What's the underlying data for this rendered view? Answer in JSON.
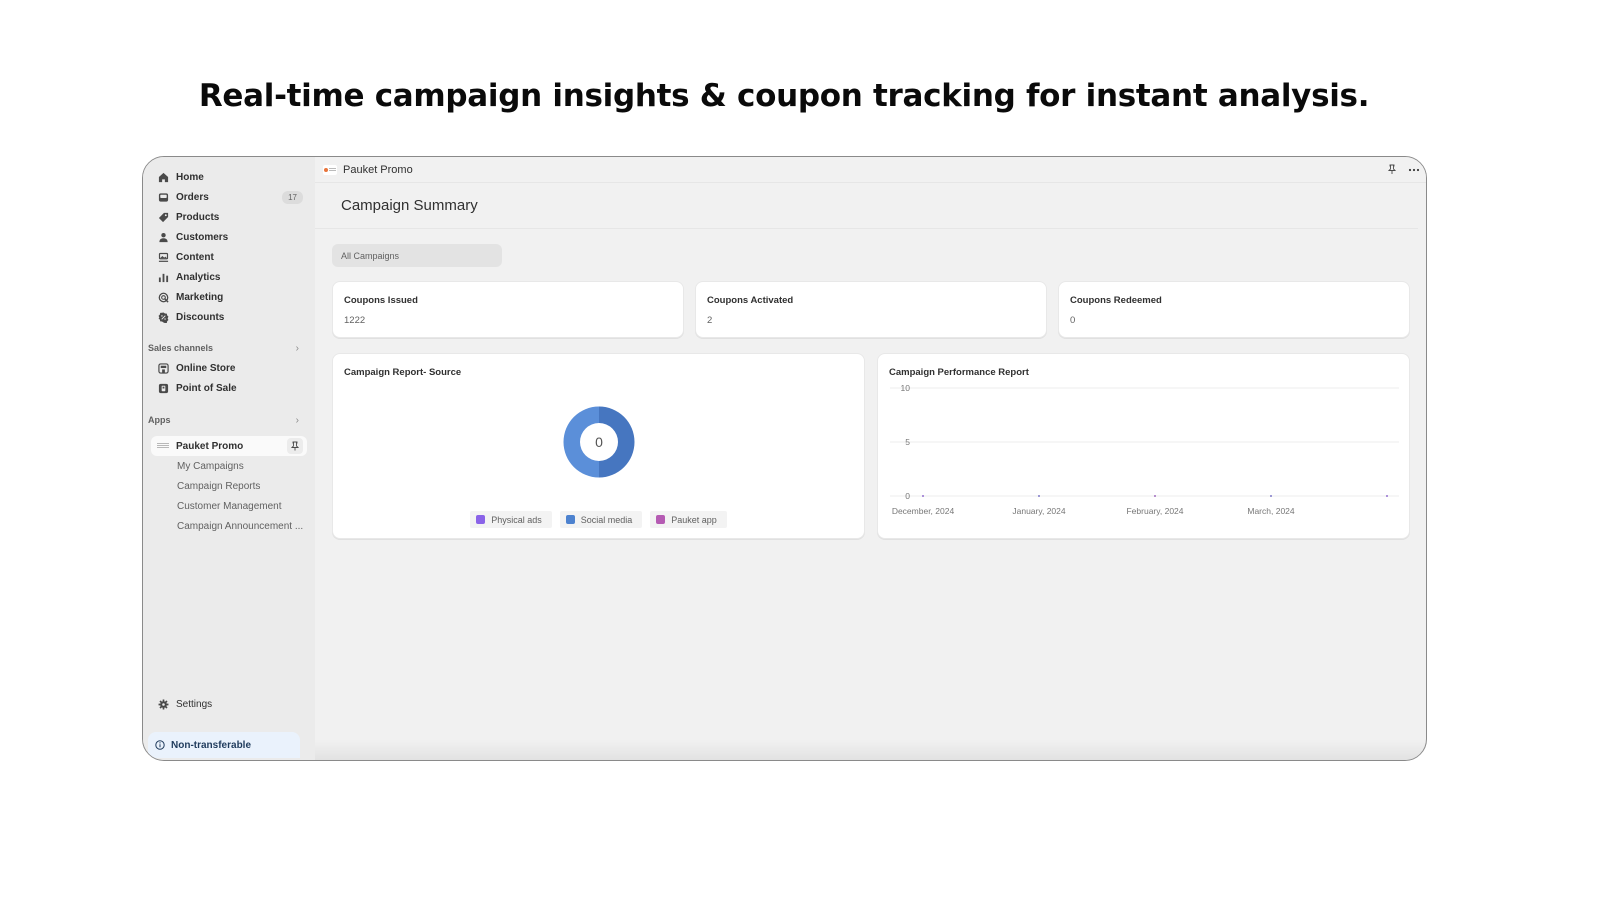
{
  "headline": "Real-time campaign insights & coupon tracking for instant analysis.",
  "sidebar": {
    "nav": [
      {
        "label": "Home",
        "icon": "home-icon"
      },
      {
        "label": "Orders",
        "icon": "inbox-icon",
        "badge": "17"
      },
      {
        "label": "Products",
        "icon": "tag-icon"
      },
      {
        "label": "Customers",
        "icon": "person-icon"
      },
      {
        "label": "Content",
        "icon": "image-icon"
      },
      {
        "label": "Analytics",
        "icon": "bar-chart-icon"
      },
      {
        "label": "Marketing",
        "icon": "target-icon"
      },
      {
        "label": "Discounts",
        "icon": "discount-badge-icon"
      }
    ],
    "sales_channels": {
      "heading": "Sales channels",
      "items": [
        {
          "label": "Online Store",
          "icon": "store-icon"
        },
        {
          "label": "Point of Sale",
          "icon": "pos-icon"
        }
      ]
    },
    "apps": {
      "heading": "Apps",
      "app": {
        "label": "Pauket Promo",
        "icon": "pauket-logo-icon"
      },
      "sub_items": [
        "My Campaigns",
        "Campaign Reports",
        "Customer Management",
        "Campaign Announcement ..."
      ]
    },
    "settings_label": "Settings",
    "non_transferable_label": "Non-transferable"
  },
  "topbar": {
    "app_name": "Pauket Promo"
  },
  "page": {
    "title": "Campaign Summary",
    "filter_value": "All Campaigns"
  },
  "stats": [
    {
      "title": "Coupons Issued",
      "value": "1222"
    },
    {
      "title": "Coupons Activated",
      "value": "2"
    },
    {
      "title": "Coupons Redeemed",
      "value": "0"
    }
  ],
  "colors": {
    "physical_ads": "#8a63e8",
    "social_media": "#4d82cf",
    "pauket_app": "#b55bb3",
    "donut_light": "#5b8fd9",
    "donut_dark": "#4676c0"
  },
  "chart_data": [
    {
      "type": "pie",
      "title": "Campaign Report- Source",
      "center_label": "0",
      "categories": [
        "Physical ads",
        "Social media",
        "Pauket app"
      ],
      "values": [
        0,
        0,
        0
      ],
      "legend": "bottom"
    },
    {
      "type": "line",
      "title": "Campaign Performance Report",
      "categories": [
        "December, 2024",
        "January, 2024",
        "February, 2024",
        "March, 2024",
        ""
      ],
      "series": [
        {
          "name": "Physical ads",
          "values": [
            0,
            0,
            0,
            0,
            0
          ]
        },
        {
          "name": "Social media",
          "values": [
            0,
            0,
            0,
            0,
            0
          ]
        },
        {
          "name": "Pauket app",
          "values": [
            0,
            0,
            0,
            0,
            0
          ]
        }
      ],
      "yticks": [
        0,
        5,
        10
      ],
      "ylim": [
        0,
        10
      ],
      "grid": true
    }
  ]
}
